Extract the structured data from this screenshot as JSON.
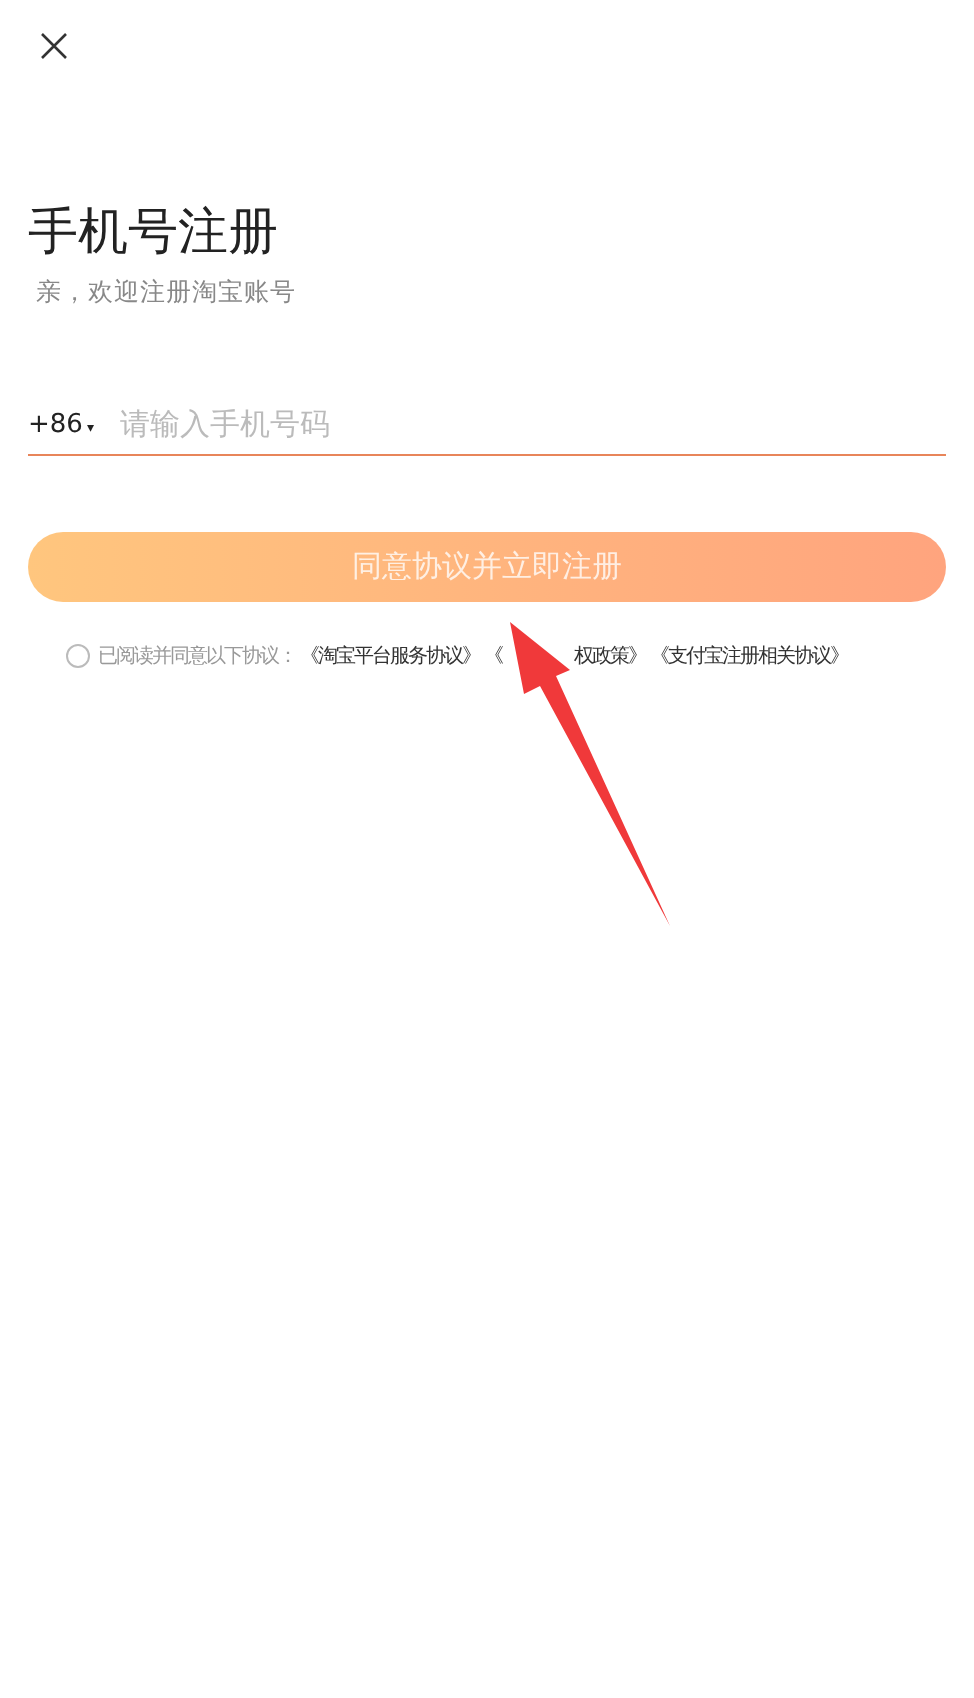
{
  "title": "手机号注册",
  "subtitle": "亲，欢迎注册淘宝账号",
  "phone": {
    "country_code": "+86",
    "caret": "▾",
    "placeholder": "请输入手机号码"
  },
  "register_button": {
    "label": "同意协议并立即注册",
    "disabled": true
  },
  "agreement": {
    "checked": false,
    "text": "已阅读并同意以下协议：",
    "links": [
      "《淘宝平台服务协议》",
      "《",
      "权政策》",
      "《支付宝注册相关协议》"
    ]
  }
}
